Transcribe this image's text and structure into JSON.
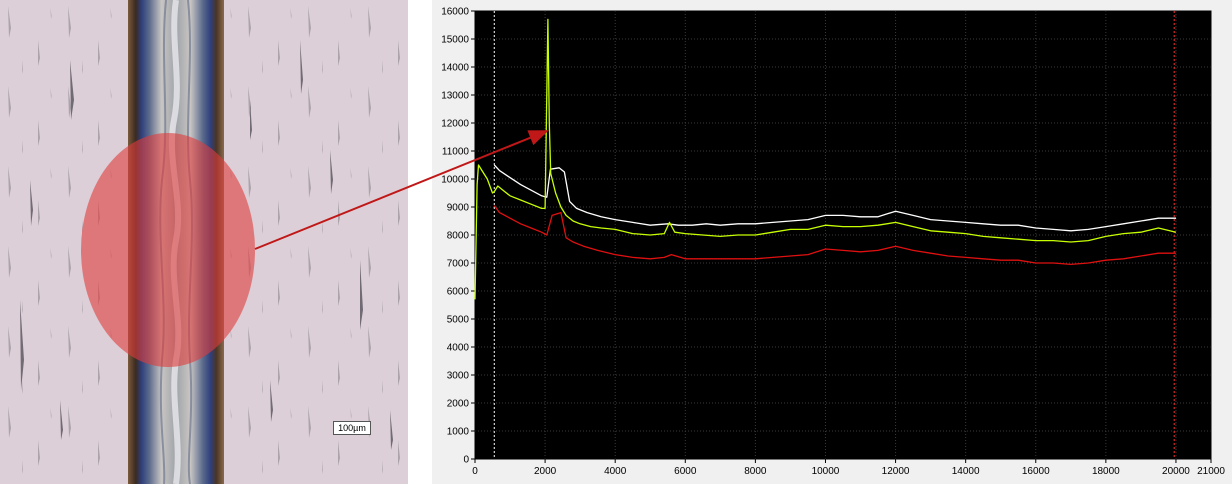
{
  "micrograph": {
    "scale_bar_label": "100µm",
    "highlight_color": "#e03c3c"
  },
  "chart_data": {
    "type": "line",
    "title": "",
    "xlabel": "",
    "ylabel": "",
    "xlim": [
      0,
      21000
    ],
    "ylim": [
      0,
      16000
    ],
    "x_ticks": [
      0,
      2000,
      4000,
      6000,
      8000,
      10000,
      12000,
      14000,
      16000,
      18000,
      20000,
      21000
    ],
    "y_ticks": [
      0,
      1000,
      2000,
      3000,
      4000,
      5000,
      6000,
      7000,
      8000,
      9000,
      10000,
      11000,
      12000,
      13000,
      14000,
      15000,
      16000
    ],
    "grid": true,
    "background": "#000000",
    "vertical_markers": [
      {
        "x": 550,
        "color": "#ffffff"
      },
      {
        "x": 19950,
        "color": "#ff3030"
      }
    ],
    "series": [
      {
        "color": "#ffffff",
        "points": [
          [
            550,
            10500
          ],
          [
            700,
            10300
          ],
          [
            1000,
            10050
          ],
          [
            1300,
            9800
          ],
          [
            1600,
            9600
          ],
          [
            1900,
            9400
          ],
          [
            2050,
            9350
          ],
          [
            2150,
            10350
          ],
          [
            2400,
            10400
          ],
          [
            2550,
            10250
          ],
          [
            2700,
            9200
          ],
          [
            2900,
            8950
          ],
          [
            3200,
            8800
          ],
          [
            3600,
            8650
          ],
          [
            4000,
            8550
          ],
          [
            4500,
            8450
          ],
          [
            5000,
            8350
          ],
          [
            5500,
            8400
          ],
          [
            5800,
            8350
          ],
          [
            6200,
            8350
          ],
          [
            6600,
            8400
          ],
          [
            7000,
            8350
          ],
          [
            7500,
            8400
          ],
          [
            8000,
            8400
          ],
          [
            8500,
            8450
          ],
          [
            9000,
            8500
          ],
          [
            9500,
            8550
          ],
          [
            10000,
            8700
          ],
          [
            10500,
            8700
          ],
          [
            11000,
            8650
          ],
          [
            11500,
            8650
          ],
          [
            12000,
            8850
          ],
          [
            12500,
            8700
          ],
          [
            13000,
            8550
          ],
          [
            13500,
            8500
          ],
          [
            14000,
            8450
          ],
          [
            14500,
            8400
          ],
          [
            15000,
            8350
          ],
          [
            15500,
            8350
          ],
          [
            16000,
            8250
          ],
          [
            16500,
            8200
          ],
          [
            17000,
            8150
          ],
          [
            17500,
            8200
          ],
          [
            18000,
            8300
          ],
          [
            18500,
            8400
          ],
          [
            19000,
            8500
          ],
          [
            19500,
            8600
          ],
          [
            20000,
            8600
          ]
        ]
      },
      {
        "color": "#c8ff00",
        "points": [
          [
            0,
            5700
          ],
          [
            60,
            9800
          ],
          [
            100,
            10500
          ],
          [
            200,
            10300
          ],
          [
            350,
            10000
          ],
          [
            500,
            9500
          ],
          [
            550,
            9550
          ],
          [
            650,
            9750
          ],
          [
            800,
            9600
          ],
          [
            1000,
            9400
          ],
          [
            1300,
            9250
          ],
          [
            1600,
            9100
          ],
          [
            1900,
            8950
          ],
          [
            2000,
            8950
          ],
          [
            2080,
            15700
          ],
          [
            2120,
            12000
          ],
          [
            2160,
            10200
          ],
          [
            2300,
            9500
          ],
          [
            2450,
            9000
          ],
          [
            2600,
            8700
          ],
          [
            2800,
            8500
          ],
          [
            3000,
            8400
          ],
          [
            3300,
            8300
          ],
          [
            3600,
            8250
          ],
          [
            4000,
            8200
          ],
          [
            4500,
            8050
          ],
          [
            5000,
            8000
          ],
          [
            5400,
            8050
          ],
          [
            5550,
            8450
          ],
          [
            5700,
            8100
          ],
          [
            6000,
            8050
          ],
          [
            6500,
            8000
          ],
          [
            7000,
            7950
          ],
          [
            7500,
            8000
          ],
          [
            8000,
            8000
          ],
          [
            8500,
            8100
          ],
          [
            9000,
            8200
          ],
          [
            9500,
            8200
          ],
          [
            10000,
            8350
          ],
          [
            10500,
            8300
          ],
          [
            11000,
            8300
          ],
          [
            11500,
            8350
          ],
          [
            12000,
            8450
          ],
          [
            12500,
            8300
          ],
          [
            13000,
            8150
          ],
          [
            13500,
            8100
          ],
          [
            14000,
            8050
          ],
          [
            14500,
            7950
          ],
          [
            15000,
            7900
          ],
          [
            15500,
            7850
          ],
          [
            16000,
            7800
          ],
          [
            16500,
            7800
          ],
          [
            17000,
            7750
          ],
          [
            17500,
            7800
          ],
          [
            18000,
            7950
          ],
          [
            18500,
            8050
          ],
          [
            19000,
            8100
          ],
          [
            19500,
            8250
          ],
          [
            20000,
            8100
          ]
        ]
      },
      {
        "color": "#e01010",
        "points": [
          [
            550,
            9050
          ],
          [
            700,
            8800
          ],
          [
            1000,
            8600
          ],
          [
            1300,
            8400
          ],
          [
            1600,
            8250
          ],
          [
            1900,
            8100
          ],
          [
            2050,
            8000
          ],
          [
            2200,
            8700
          ],
          [
            2450,
            8800
          ],
          [
            2600,
            7900
          ],
          [
            2800,
            7750
          ],
          [
            3100,
            7600
          ],
          [
            3500,
            7450
          ],
          [
            4000,
            7300
          ],
          [
            4500,
            7200
          ],
          [
            5000,
            7150
          ],
          [
            5400,
            7200
          ],
          [
            5600,
            7300
          ],
          [
            6000,
            7150
          ],
          [
            6500,
            7150
          ],
          [
            7000,
            7150
          ],
          [
            7500,
            7150
          ],
          [
            8000,
            7150
          ],
          [
            8500,
            7200
          ],
          [
            9000,
            7250
          ],
          [
            9500,
            7300
          ],
          [
            10000,
            7500
          ],
          [
            10500,
            7450
          ],
          [
            11000,
            7400
          ],
          [
            11500,
            7450
          ],
          [
            12000,
            7600
          ],
          [
            12500,
            7450
          ],
          [
            13000,
            7350
          ],
          [
            13500,
            7250
          ],
          [
            14000,
            7200
          ],
          [
            14500,
            7150
          ],
          [
            15000,
            7100
          ],
          [
            15500,
            7100
          ],
          [
            16000,
            7000
          ],
          [
            16500,
            7000
          ],
          [
            17000,
            6950
          ],
          [
            17500,
            7000
          ],
          [
            18000,
            7100
          ],
          [
            18500,
            7150
          ],
          [
            19000,
            7250
          ],
          [
            19500,
            7350
          ],
          [
            20000,
            7350
          ]
        ]
      }
    ]
  },
  "callout": {
    "color": "#c01818"
  }
}
